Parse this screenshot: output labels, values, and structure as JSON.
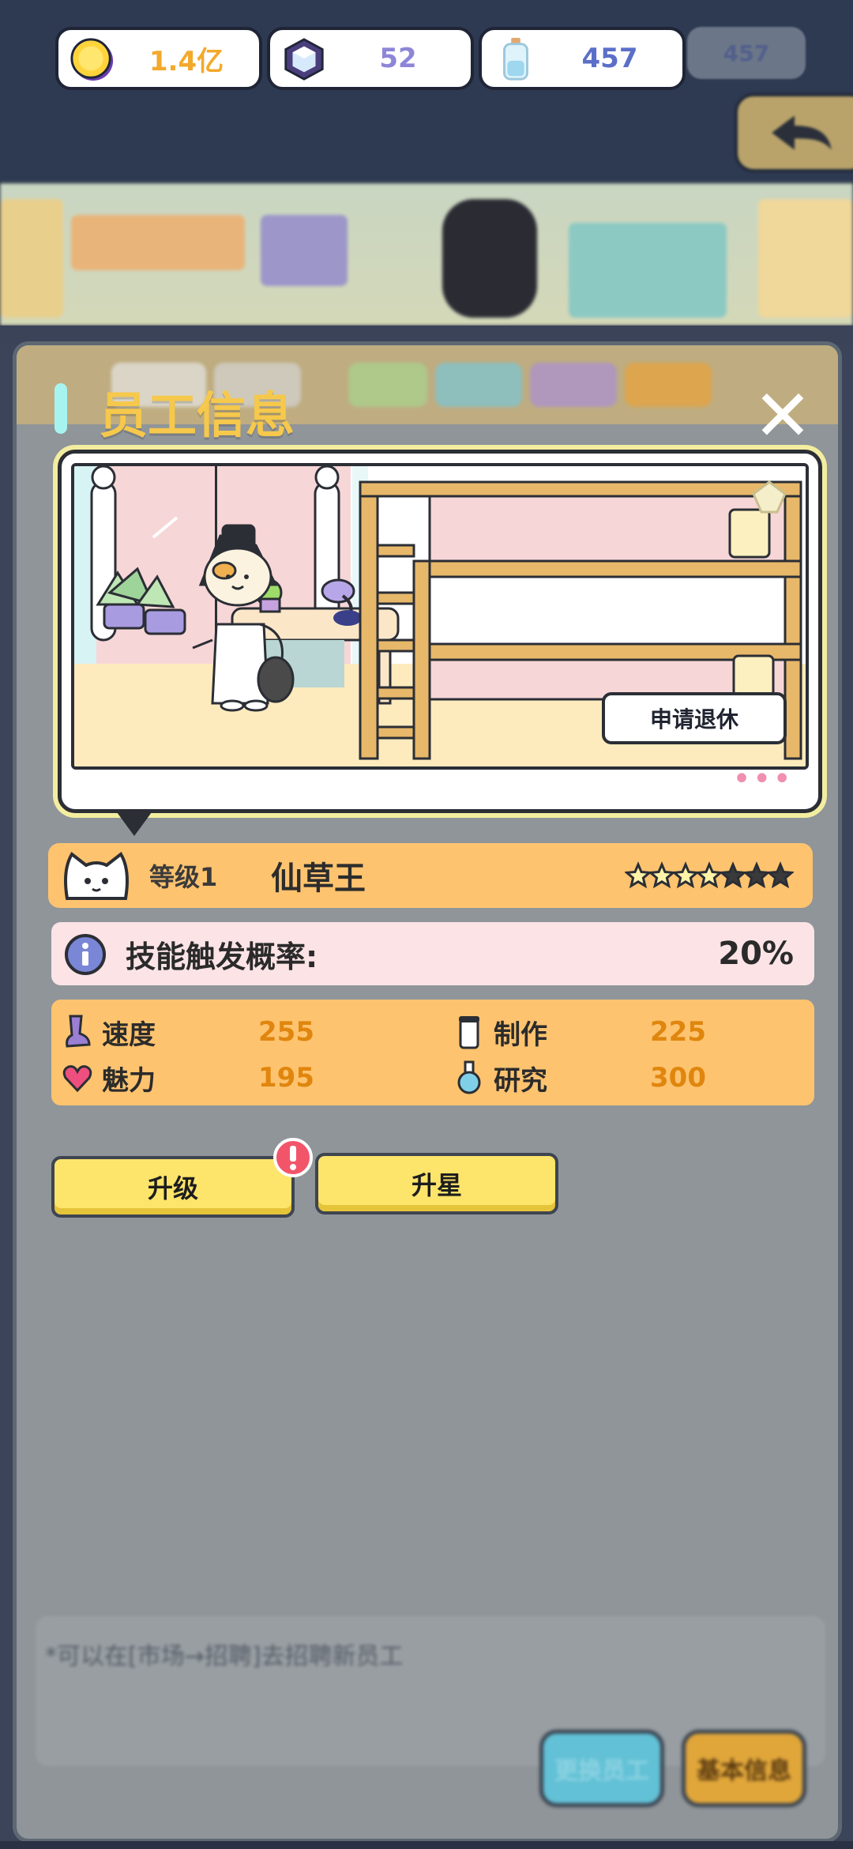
{
  "resources": [
    {
      "name": "gold-coin-icon",
      "value": "1.4亿",
      "color": "#f3a92b"
    },
    {
      "name": "gem-icon",
      "value": "52",
      "color": "#8d86d8"
    },
    {
      "name": "potion-bottle-icon",
      "value": "457",
      "color": "#5b6fc9"
    }
  ],
  "resource_ghost_value": "457",
  "panel": {
    "title": "员工信息",
    "close_icon": "✕"
  },
  "portrait": {
    "retire_label": "申请退休",
    "dots": "•••"
  },
  "employee": {
    "level_label": "等级1",
    "name": "仙草王",
    "stars_filled": 4,
    "stars_total": 7
  },
  "skill": {
    "label": "技能触发概率:",
    "value": "20%"
  },
  "stats": [
    {
      "icon": "boot-icon",
      "label": "速度",
      "value": "255"
    },
    {
      "icon": "cup-icon",
      "label": "制作",
      "value": "225"
    },
    {
      "icon": "heart-icon",
      "label": "魅力",
      "value": "195"
    },
    {
      "icon": "flask-icon",
      "label": "研究",
      "value": "300"
    }
  ],
  "actions": {
    "upgrade_label": "升级",
    "star_up_label": "升星"
  },
  "footer": {
    "hint": "*可以在[市场→招聘]去招聘新员工",
    "left_button": "更换员工",
    "right_button": "基本信息"
  },
  "colors": {
    "title": "#f6c84b",
    "name_bar": "#fec36f",
    "skill_bar": "#fbe3e6",
    "stat_value": "#e0860e",
    "action_button": "#fde46b"
  }
}
